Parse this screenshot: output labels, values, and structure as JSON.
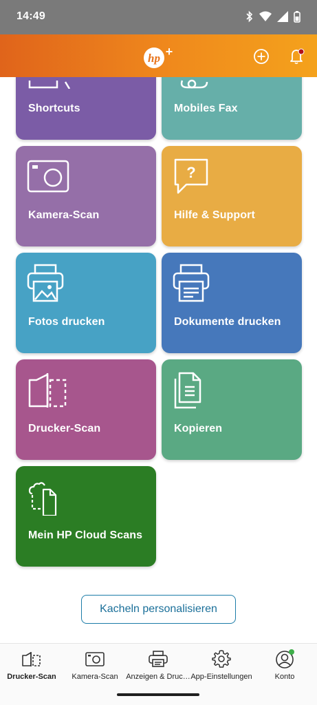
{
  "status_bar": {
    "time": "14:49"
  },
  "header": {
    "logo_text": "hp+",
    "add_icon": "add-circle-icon",
    "bell_icon": "bell-icon",
    "accent": "#f08a1c"
  },
  "tiles": [
    {
      "label": "Shortcuts",
      "color": "#7b5ca6",
      "icon": "shortcut-icon"
    },
    {
      "label": "Mobiles Fax",
      "color": "#66afa9",
      "icon": "fax-icon"
    },
    {
      "label": "Kamera-Scan",
      "color": "#956fa8",
      "icon": "camera-icon"
    },
    {
      "label": "Hilfe & Support",
      "color": "#e8ac44",
      "icon": "help-icon"
    },
    {
      "label": "Fotos drucken",
      "color": "#47a2c5",
      "icon": "photo-print-icon"
    },
    {
      "label": "Dokumente drucken",
      "color": "#4678bb",
      "icon": "document-print-icon"
    },
    {
      "label": "Drucker-Scan",
      "color": "#a7568d",
      "icon": "printer-scan-icon"
    },
    {
      "label": "Kopieren",
      "color": "#5aa983",
      "icon": "copy-icon"
    },
    {
      "label": "Mein HP Cloud Scans",
      "color": "#2b7d24",
      "icon": "cloud-scan-icon"
    }
  ],
  "personalize_button": "Kacheln personalisieren",
  "bottom_nav": [
    {
      "label": "Drucker-Scan",
      "icon": "printer-scan-icon",
      "active": true
    },
    {
      "label": "Kamera-Scan",
      "icon": "camera-icon",
      "active": false
    },
    {
      "label": "Anzeigen & Druc…",
      "icon": "printer-icon",
      "active": false
    },
    {
      "label": "App-Einstellungen",
      "icon": "gear-icon",
      "active": false
    },
    {
      "label": "Konto",
      "icon": "account-icon",
      "active": false
    }
  ]
}
